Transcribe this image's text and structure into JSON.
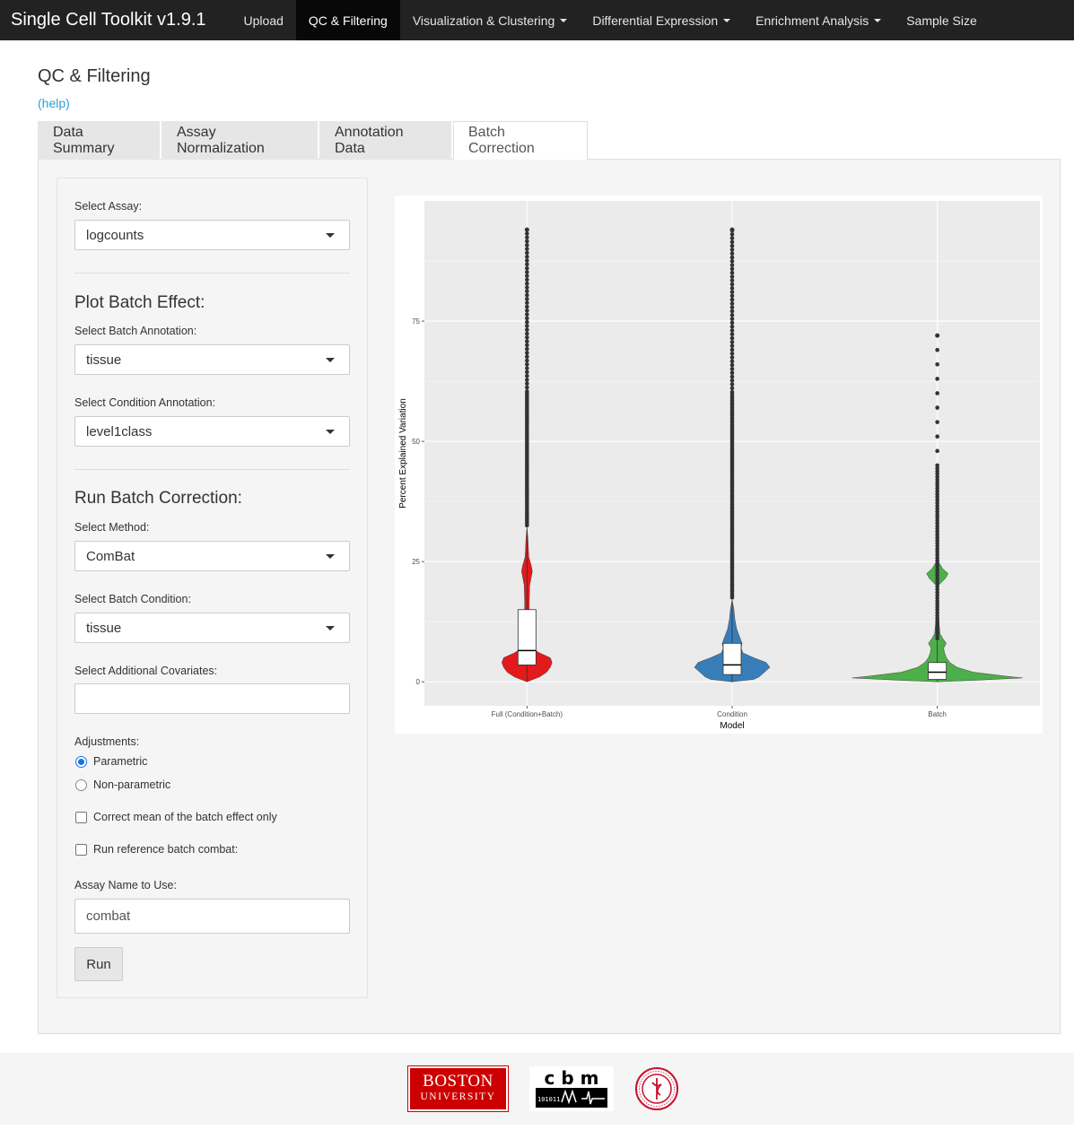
{
  "navbar": {
    "brand": "Single Cell Toolkit v1.9.1",
    "items": [
      {
        "label": "Upload",
        "dropdown": false,
        "active": false
      },
      {
        "label": "QC & Filtering",
        "dropdown": false,
        "active": true
      },
      {
        "label": "Visualization & Clustering",
        "dropdown": true,
        "active": false
      },
      {
        "label": "Differential Expression",
        "dropdown": true,
        "active": false
      },
      {
        "label": "Enrichment Analysis",
        "dropdown": true,
        "active": false
      },
      {
        "label": "Sample Size",
        "dropdown": false,
        "active": false
      }
    ]
  },
  "page": {
    "title": "QC & Filtering",
    "help": "(help)"
  },
  "tabs": [
    "Data Summary",
    "Assay Normalization",
    "Annotation Data",
    "Batch Correction"
  ],
  "active_tab": "Batch Correction",
  "sidebar": {
    "assay_label": "Select Assay:",
    "assay_value": "logcounts",
    "plot_section": "Plot Batch Effect:",
    "batch_annot_label": "Select Batch Annotation:",
    "batch_annot_value": "tissue",
    "cond_annot_label": "Select Condition Annotation:",
    "cond_annot_value": "level1class",
    "run_section": "Run Batch Correction:",
    "method_label": "Select Method:",
    "method_value": "ComBat",
    "batch_cond_label": "Select Batch Condition:",
    "batch_cond_value": "tissue",
    "covariates_label": "Select Additional Covariates:",
    "covariates_value": "",
    "adjustments_label": "Adjustments:",
    "adjustments": [
      {
        "label": "Parametric",
        "selected": true
      },
      {
        "label": "Non-parametric",
        "selected": false
      }
    ],
    "mean_only_label": "Correct mean of the batch effect only",
    "mean_only_checked": false,
    "ref_batch_label": "Run reference batch combat:",
    "ref_batch_checked": false,
    "assay_name_label": "Assay Name to Use:",
    "assay_name_value": "combat",
    "run_button": "Run"
  },
  "chart_data": {
    "type": "violin",
    "xlabel": "Model",
    "ylabel": "Percent Explained Variation",
    "ylim": [
      -5,
      100
    ],
    "yticks": [
      0,
      25,
      50,
      75
    ],
    "categories": [
      "Full (Condition+Batch)",
      "Condition",
      "Batch"
    ],
    "colors": [
      "#e31a1c",
      "#377eb8",
      "#4daf4a"
    ],
    "boxplots": [
      {
        "name": "Full (Condition+Batch)",
        "whisker_low": 0,
        "q1": 3.5,
        "median": 6.5,
        "q3": 15,
        "whisker_high": 32,
        "max_outlier": 94
      },
      {
        "name": "Condition",
        "whisker_low": 0,
        "q1": 1.5,
        "median": 3.5,
        "q3": 8,
        "whisker_high": 17,
        "max_outlier": 94
      },
      {
        "name": "Batch",
        "whisker_low": 0,
        "q1": 0.5,
        "median": 2,
        "q3": 4,
        "whisker_high": 8.5,
        "max_outlier": 72
      }
    ],
    "grid": true,
    "legend": "none"
  },
  "footer": {
    "logos": [
      "Boston University",
      "cbm",
      "university seal"
    ],
    "bu_line1": "BOSTON",
    "bu_line2": "UNIVERSITY",
    "cbm_text": "c b m"
  }
}
